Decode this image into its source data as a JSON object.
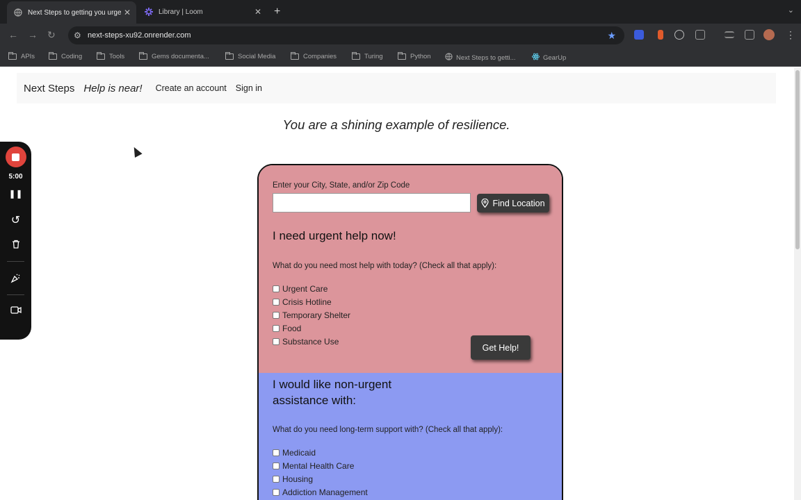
{
  "browser": {
    "tabs": [
      {
        "title": "Next Steps to getting you urgent",
        "active": true
      },
      {
        "title": "Library | Loom",
        "active": false
      }
    ],
    "url": "next-steps-xu92.onrender.com",
    "bookmarks": [
      {
        "label": "APIs",
        "icon": "folder-icon"
      },
      {
        "label": "Coding",
        "icon": "folder-icon"
      },
      {
        "label": "Tools",
        "icon": "folder-icon"
      },
      {
        "label": "Gems documenta...",
        "icon": "folder-icon"
      },
      {
        "label": "Social Media",
        "icon": "folder-icon"
      },
      {
        "label": "Companies",
        "icon": "folder-icon"
      },
      {
        "label": "Turing",
        "icon": "folder-icon"
      },
      {
        "label": "Python",
        "icon": "folder-icon"
      },
      {
        "label": "Next Steps to getti...",
        "icon": "globe-icon"
      },
      {
        "label": "GearUp",
        "icon": "react-icon"
      }
    ]
  },
  "navbar": {
    "brand": "Next Steps",
    "tagline": "Help is near!",
    "links": [
      "Create an account",
      "Sign in"
    ]
  },
  "quote": "You are a shining example of resilience.",
  "form": {
    "location_label": "Enter your City, State, and/or Zip Code",
    "location_value": "",
    "find_location_label": "Find Location",
    "urgent": {
      "heading": "I need urgent help now!",
      "prompt": "What do you need most help with today? (Check all that apply):",
      "options": [
        "Urgent Care",
        "Crisis Hotline",
        "Temporary Shelter",
        "Food",
        "Substance Use"
      ],
      "submit_label": "Get Help!"
    },
    "non_urgent": {
      "heading_line1": "I would like non-urgent",
      "heading_line2": "assistance with:",
      "prompt": "What do you need long-term support with? (Check all that apply):",
      "options": [
        "Medicaid",
        "Mental Health Care",
        "Housing",
        "Addiction Management"
      ]
    }
  },
  "recorder": {
    "timer": "5:00",
    "accent": "#e0443c"
  },
  "colors": {
    "urgent_bg": "#dc959b",
    "non_urgent_bg": "#8c9af2"
  }
}
